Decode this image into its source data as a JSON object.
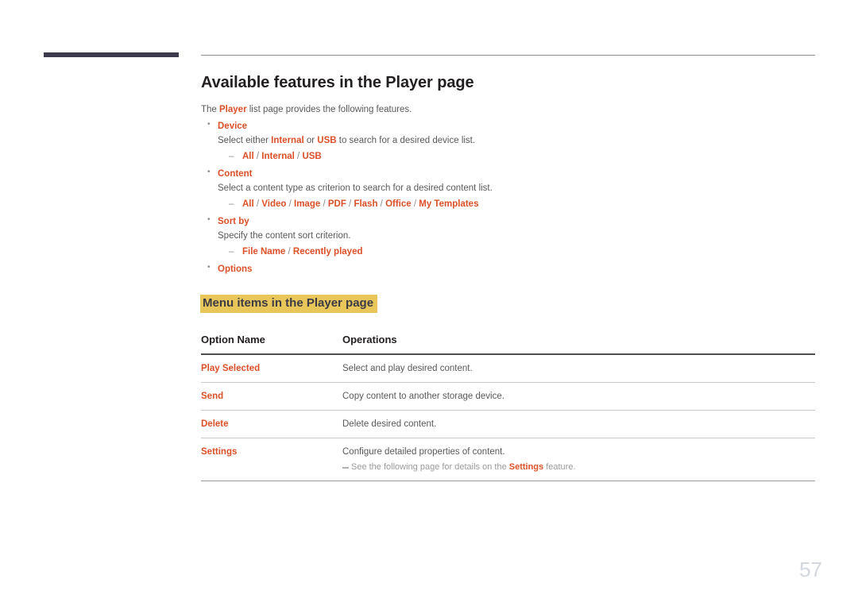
{
  "page": {
    "number": "57"
  },
  "header": {
    "title": "Available features in the Player page"
  },
  "intro": {
    "before": "The ",
    "emphasis": "Player",
    "after": " list page provides the following features."
  },
  "bullets": [
    {
      "title": "Device",
      "desc_parts": [
        {
          "text": "Select either ",
          "emph": false
        },
        {
          "text": "Internal",
          "emph": true
        },
        {
          "text": " or ",
          "emph": false
        },
        {
          "text": "USB",
          "emph": true
        },
        {
          "text": " to search for a desired device list.",
          "emph": false
        }
      ],
      "options": [
        "All",
        "Internal",
        "USB"
      ]
    },
    {
      "title": "Content",
      "desc_parts": [
        {
          "text": "Select a content type as criterion to search for a desired content list.",
          "emph": false
        }
      ],
      "options": [
        "All",
        "Video",
        "Image",
        "PDF",
        "Flash",
        "Office",
        "My Templates"
      ]
    },
    {
      "title": "Sort by",
      "desc_parts": [
        {
          "text": "Specify the content sort criterion.",
          "emph": false
        }
      ],
      "options": [
        "File Name",
        "Recently played"
      ]
    },
    {
      "title": "Options",
      "desc_parts": [],
      "options": []
    }
  ],
  "section_heading": "Menu items in the Player page",
  "table": {
    "columns": [
      "Option Name",
      "Operations"
    ],
    "rows": [
      {
        "name": "Play Selected",
        "desc": "Select and play desired content.",
        "note": null
      },
      {
        "name": "Send",
        "desc": "Copy content to another storage device.",
        "note": null
      },
      {
        "name": "Delete",
        "desc": "Delete desired content.",
        "note": null
      },
      {
        "name": "Settings",
        "desc": "Configure detailed properties of content.",
        "note": {
          "before": "See the following page for details on the ",
          "emphasis": "Settings",
          "after": " feature."
        }
      }
    ]
  },
  "colors": {
    "accent_orange": "#dd4f26",
    "highlight_gold": "#e8c65a",
    "bar_purple": "#3d3a4d",
    "body_gray": "#595959",
    "page_number_gray": "#d3d7de"
  }
}
